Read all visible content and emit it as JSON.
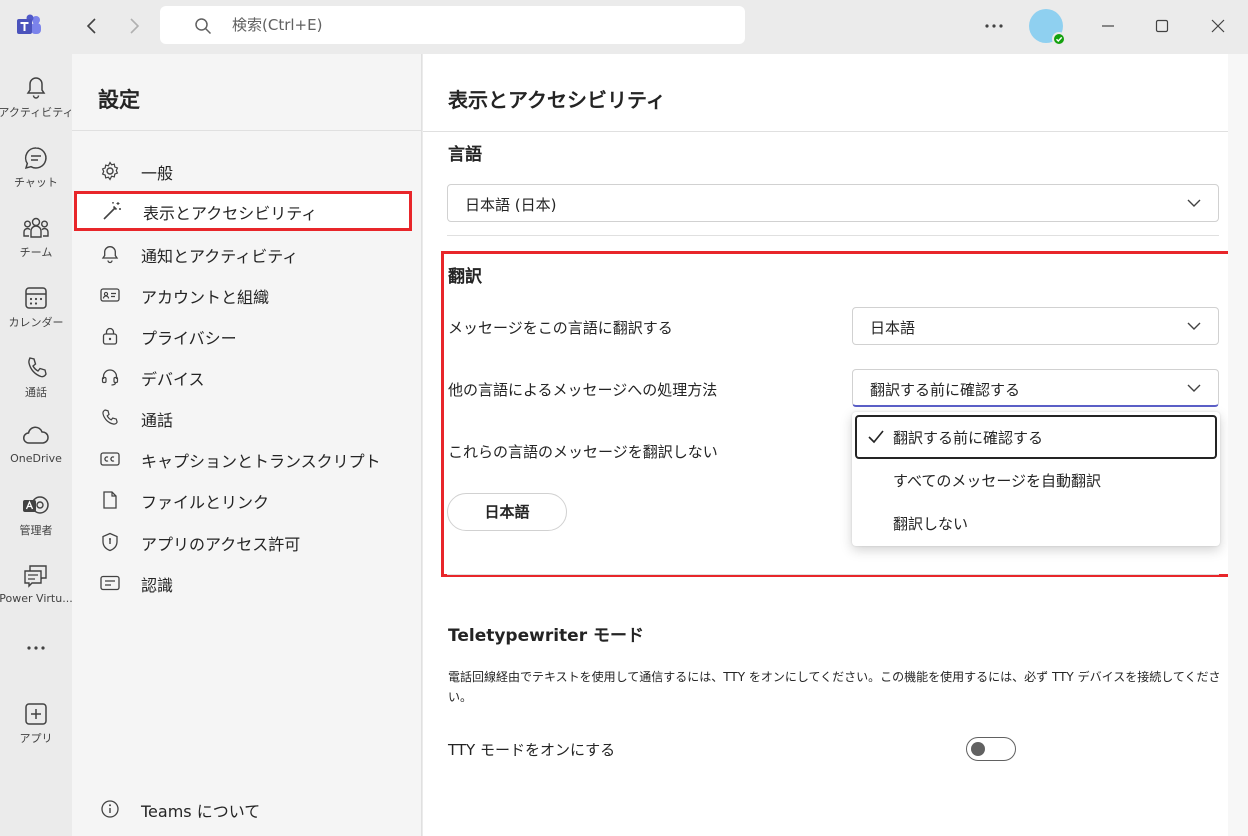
{
  "titlebar": {
    "search_placeholder": "検索(Ctrl+E)"
  },
  "rail": {
    "items": [
      {
        "label": "アクティビティ",
        "icon": "bell-icon"
      },
      {
        "label": "チャット",
        "icon": "chat-icon"
      },
      {
        "label": "チーム",
        "icon": "teams-icon"
      },
      {
        "label": "カレンダー",
        "icon": "calendar-icon"
      },
      {
        "label": "通話",
        "icon": "phone-icon"
      },
      {
        "label": "OneDrive",
        "icon": "cloud-icon"
      },
      {
        "label": "管理者",
        "icon": "admin-icon"
      },
      {
        "label": "Power Virtu...",
        "icon": "power-virtual-agents-icon"
      },
      {
        "label": "アプリ",
        "icon": "add-app-icon"
      }
    ]
  },
  "settings": {
    "title": "設定",
    "items": [
      {
        "label": "一般",
        "icon": "gear-icon"
      },
      {
        "label": "表示とアクセシビリティ",
        "icon": "magic-wand-icon",
        "active": true
      },
      {
        "label": "通知とアクティビティ",
        "icon": "bell-icon"
      },
      {
        "label": "アカウントと組織",
        "icon": "id-card-icon"
      },
      {
        "label": "プライバシー",
        "icon": "lock-icon"
      },
      {
        "label": "デバイス",
        "icon": "headset-icon"
      },
      {
        "label": "通話",
        "icon": "phone-icon"
      },
      {
        "label": "キャプションとトランスクリプト",
        "icon": "cc-icon"
      },
      {
        "label": "ファイルとリンク",
        "icon": "file-icon"
      },
      {
        "label": "アプリのアクセス許可",
        "icon": "shield-icon"
      },
      {
        "label": "認識",
        "icon": "text-box-icon"
      }
    ],
    "about": {
      "label": "Teams について",
      "icon": "info-icon"
    }
  },
  "main": {
    "title": "表示とアクセシビリティ",
    "language": {
      "heading": "言語",
      "value": "日本語 (日本)"
    },
    "translation": {
      "heading": "翻訳",
      "translate_to_label": "メッセージをこの言語に翻訳する",
      "translate_to_value": "日本語",
      "handling_label": "他の言語によるメッセージへの処理方法",
      "handling_value": "翻訳する前に確認する",
      "handling_options": [
        "翻訳する前に確認する",
        "すべてのメッセージを自動翻訳",
        "翻訳しない"
      ],
      "do_not_translate_label": "これらの言語のメッセージを翻訳しない",
      "do_not_translate_chip": "日本語"
    },
    "tty": {
      "heading": "Teletypewriter モード",
      "description": "電話回線経由でテキストを使用して通信するには、TTY をオンにしてください。この機能を使用するには、必ず TTY デバイスを接続してください。",
      "toggle_label": "TTY モードをオンにする",
      "enabled": false
    }
  },
  "colors": {
    "brand": "#5b5fc7",
    "highlight": "#e8262a",
    "presence": "#13a10e"
  }
}
